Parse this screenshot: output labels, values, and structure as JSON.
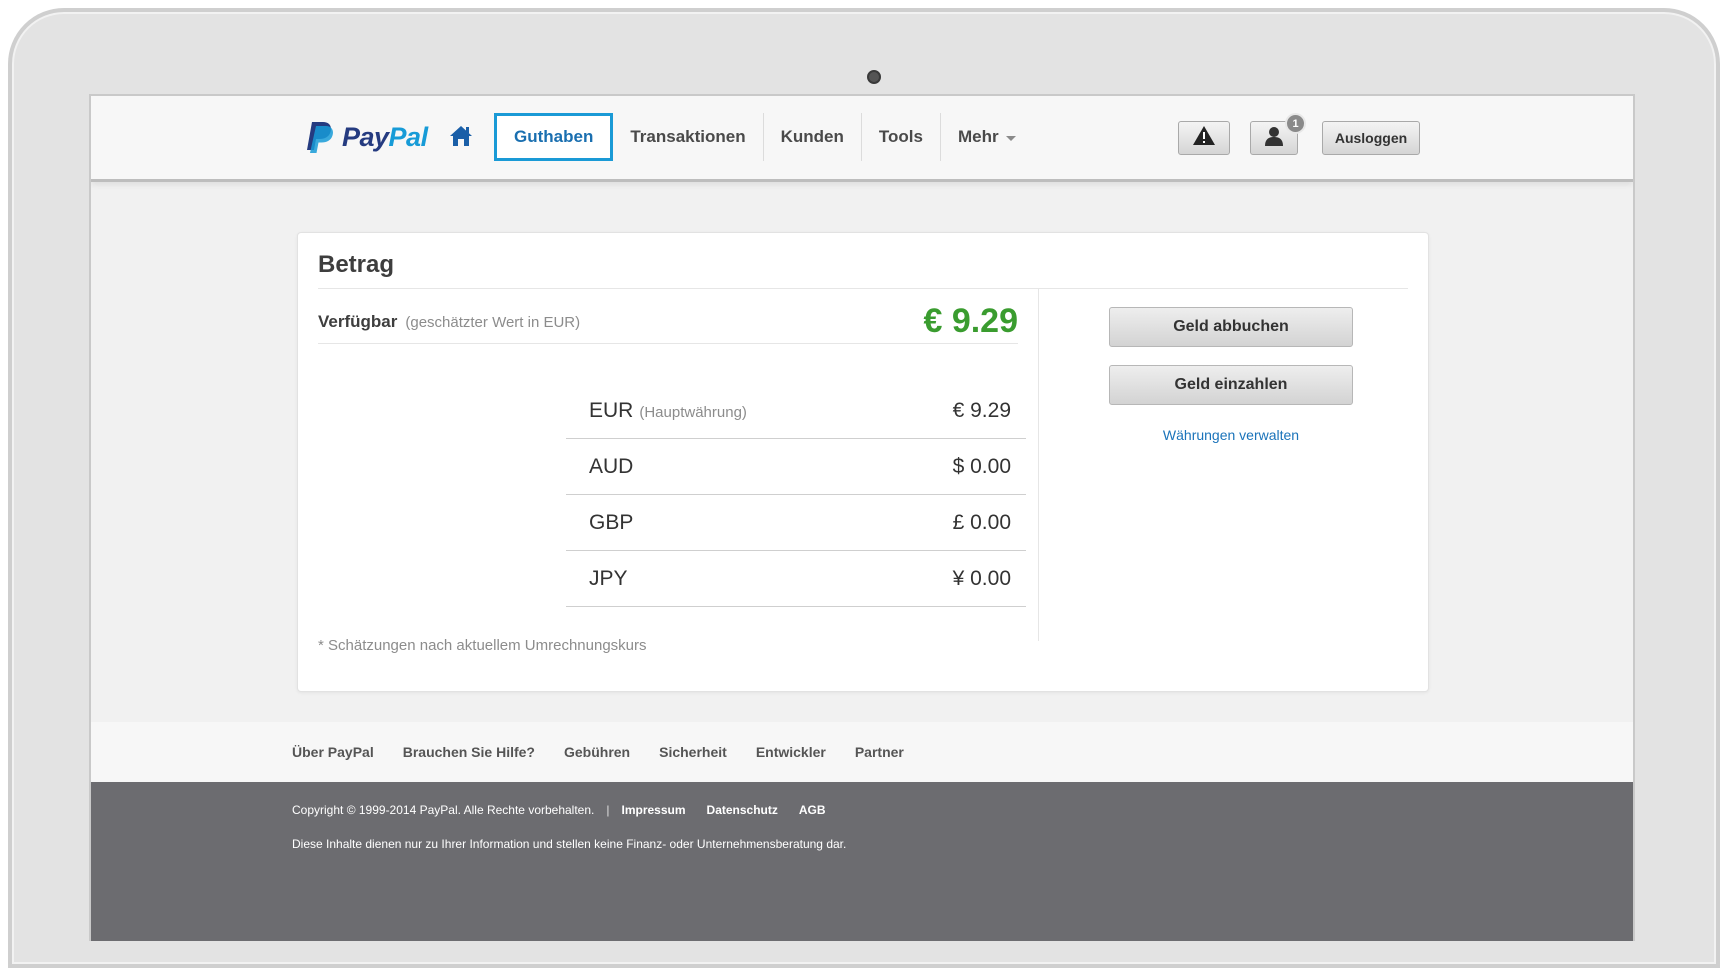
{
  "brand": {
    "pay": "Pay",
    "pal": "Pal"
  },
  "colors": {
    "accent_blue": "#1a9ad6",
    "positive_green": "#3a9c2f",
    "footer_dark": "#6c6c70"
  },
  "nav": {
    "items": [
      {
        "label": "Guthaben",
        "active": true
      },
      {
        "label": "Transaktionen"
      },
      {
        "label": "Kunden"
      },
      {
        "label": "Tools"
      },
      {
        "label": "Mehr"
      }
    ]
  },
  "header": {
    "notification_count": "1",
    "logout_label": "Ausloggen",
    "icons": [
      "home-icon",
      "alert-icon",
      "user-icon"
    ]
  },
  "balance": {
    "title": "Betrag",
    "available_label": "Verfügbar",
    "available_hint": "(geschätzter Wert in EUR)",
    "available_amount": "€ 9.29",
    "currencies": [
      {
        "code": "EUR",
        "note": "(Hauptwährung)",
        "value": "€ 9.29"
      },
      {
        "code": "AUD",
        "note": "",
        "value": "$ 0.00"
      },
      {
        "code": "GBP",
        "note": "",
        "value": "£ 0.00"
      },
      {
        "code": "JPY",
        "note": "",
        "value": "¥ 0.00"
      }
    ],
    "footnote": "* Schätzungen nach aktuellem Umrechnungskurs"
  },
  "actions": {
    "withdraw_label": "Geld abbuchen",
    "deposit_label": "Geld einzahlen",
    "manage_link": "Währungen verwalten"
  },
  "footer": {
    "links": [
      "Über PayPal",
      "Brauchen Sie Hilfe?",
      "Gebühren",
      "Sicherheit",
      "Entwickler",
      "Partner"
    ],
    "copyright": "Copyright © 1999-2014 PayPal. Alle Rechte vorbehalten.",
    "separator": "|",
    "legal_links": [
      "Impressum",
      "Datenschutz",
      "AGB"
    ],
    "disclaimer": "Diese Inhalte dienen nur zu Ihrer Information und stellen keine Finanz- oder Unternehmensberatung dar."
  }
}
